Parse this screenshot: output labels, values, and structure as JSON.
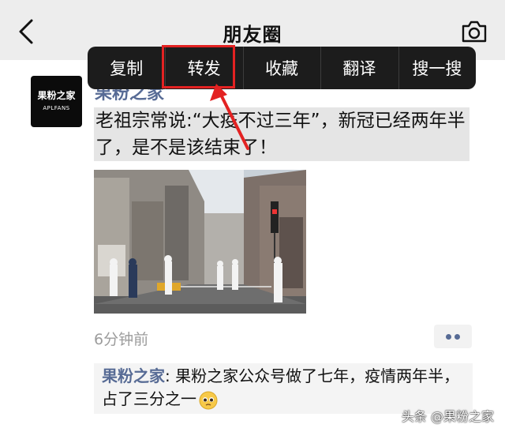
{
  "header": {
    "title": "朋友圈",
    "back_icon": "chevron-left-icon",
    "camera_icon": "camera-icon"
  },
  "context_menu": {
    "items": [
      "复制",
      "转发",
      "收藏",
      "翻译",
      "搜一搜"
    ],
    "highlighted_item": "转发",
    "highlight_color": "#e32222"
  },
  "post": {
    "avatar": {
      "name": "果粉之家",
      "sub": "APLFANS"
    },
    "poster_name": "果粉之家",
    "text": "老祖宗常说:“大疫不过三年”，新冠已经两年半了，是不是该结束了！",
    "image_icon": "street-photo",
    "time": "6分钟前",
    "more_icon": "more-dots-icon"
  },
  "comment": {
    "name": "果粉之家",
    "separator": ": ",
    "text": "果粉之家公众号做了七年，疫情两年半，占了三分之一",
    "emoji_icon": "pleading-face-emoji"
  },
  "watermark": "头条 @果粉之家",
  "colors": {
    "link": "#576b95",
    "menu_bg": "#1c1c1c",
    "header_bg": "#ededed",
    "text_highlight_bg": "#e5e5e5"
  }
}
